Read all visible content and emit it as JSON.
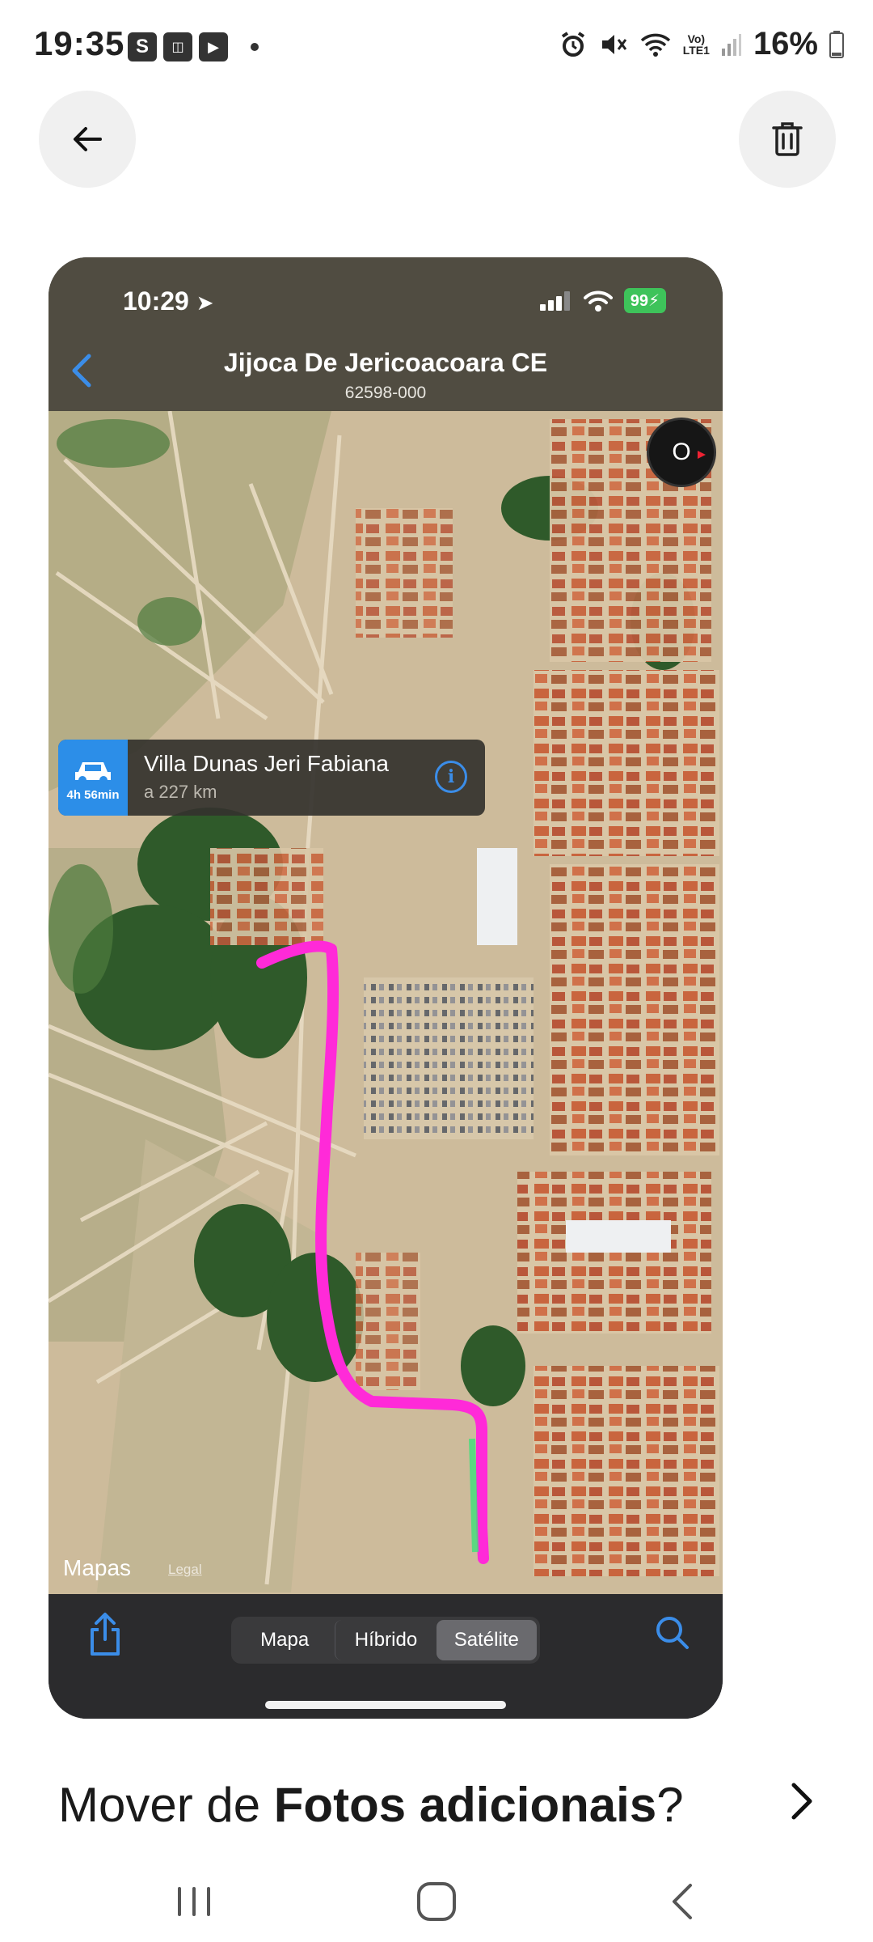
{
  "status_bar": {
    "time": "19:35",
    "left_icons": [
      "S",
      "voice-memo",
      "youtube-icon"
    ],
    "battery": "16%",
    "volte": "Vo) LTE1"
  },
  "top_actions": {
    "back_icon": "arrow-left-icon",
    "delete_icon": "trash-icon"
  },
  "screenshot": {
    "status": {
      "time": "10:29",
      "battery": "99"
    },
    "header": {
      "title": "Jijoca De Jericoacoara CE",
      "subtitle": "62598-000"
    },
    "map": {
      "callout": {
        "name": "Villa Dunas Jeri Fabiana",
        "distance": "a 227 km",
        "duration": "4h 56min"
      },
      "compass_label": "O",
      "logo": "Mapas",
      "legal": "Legal",
      "route_color": "#ff2ad8"
    },
    "toolbar": {
      "segments": [
        "Mapa",
        "Híbrido",
        "Satélite"
      ],
      "selected_segment": "Satélite"
    }
  },
  "prompt": {
    "prefix": "Mover de ",
    "folder": "Fotos adicionais",
    "suffix": "?"
  },
  "nav_bar": {
    "items": [
      "recents-icon",
      "home-icon",
      "back-icon"
    ]
  }
}
